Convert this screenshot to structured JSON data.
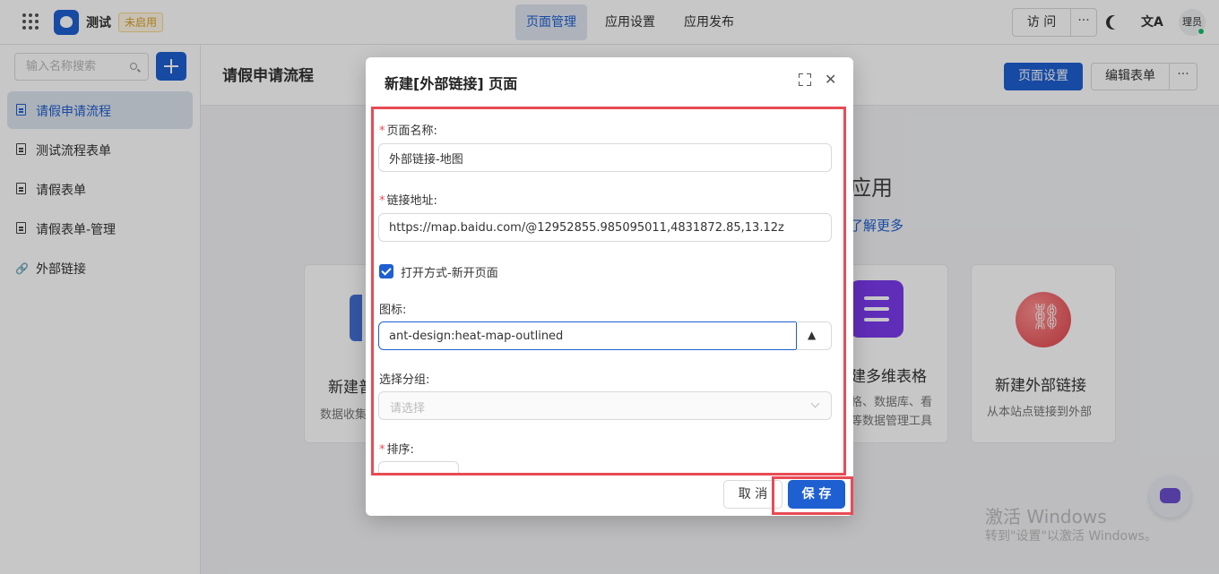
{
  "topbar": {
    "app_name": "测试",
    "app_status": "未启用",
    "tabs": [
      "页面管理",
      "应用设置",
      "应用发布"
    ],
    "active_tab": "页面管理",
    "visit_label": "访 问",
    "more_label": "···",
    "translate_glyph": "文A",
    "avatar_text": "理员",
    "accent": "#1e5fd1"
  },
  "sidebar": {
    "search_placeholder": "输入名称搜索",
    "items": [
      {
        "label": "请假申请流程",
        "icon": "document-icon",
        "active": true
      },
      {
        "label": "测试流程表单",
        "icon": "document-icon"
      },
      {
        "label": "请假表单",
        "icon": "document-icon"
      },
      {
        "label": "请假表单-管理",
        "icon": "document-icon"
      },
      {
        "label": "外部链接",
        "icon": "link-icon"
      }
    ]
  },
  "main": {
    "page_title": "请假申请流程",
    "page_settings_label": "页面设置",
    "edit_form_label": "编辑表单",
    "more_label": "···",
    "heading_fragment": "应用",
    "learn_more": "了解更多",
    "cards": [
      {
        "title": "新建普",
        "desc": "数据收集"
      },
      {
        "title": "建多维表格",
        "desc1": "格、数据库、看",
        "desc2": "等数据管理工具"
      },
      {
        "title": "新建外部链接",
        "desc": "从本站点链接到外部"
      }
    ]
  },
  "modal": {
    "title": "新建[外部链接] 页面",
    "page_name_label": "页面名称:",
    "page_name_value": "外部链接-地图",
    "url_label": "链接地址:",
    "url_value": "https://map.baidu.com/@12952855.985095011,4831872.85,13.12z",
    "open_mode_label": "打开方式-新开页面",
    "open_mode_checked": true,
    "icon_label": "图标:",
    "icon_value": "ant-design:heat-map-outlined",
    "group_label": "选择分组:",
    "group_placeholder": "请选择",
    "sort_label": "排序:",
    "cancel_label": "取 消",
    "save_label": "保 存",
    "highlight_color": "#e84b55"
  },
  "watermark": {
    "line1": "激活 Windows",
    "line2": "转到\"设置\"以激活 Windows。"
  }
}
